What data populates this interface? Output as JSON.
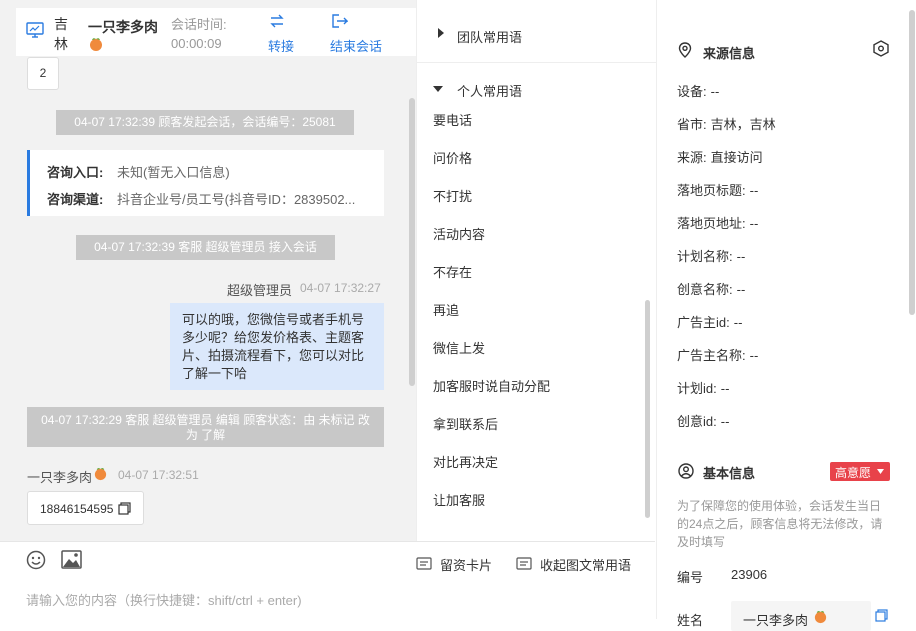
{
  "header": {
    "region": "吉林",
    "nickname": "一只李多肉",
    "session_time_label": "会话时间:",
    "session_time": "00:00:09",
    "transfer_label": "转接",
    "end_label": "结束会话"
  },
  "chat": {
    "top_count": "2",
    "sys1": "04-07 17:32:39 顾客发起会话，会话编号：25081",
    "entry_label": "咨询入口:",
    "entry_value": "未知(暂无入口信息)",
    "channel_label": "咨询渠道:",
    "channel_value": "抖音企业号/员工号(抖音号ID：2839502...",
    "sys2": "04-07 17:32:39 客服 超级管理员 接入会话",
    "agent_name": "超级管理员",
    "agent_time": "04-07 17:32:27",
    "agent_msg": "可以的哦，您微信号或者手机号多少呢？给您发价格表、主题客片、拍摄流程看下，您可以对比了解一下哈",
    "sys3": "04-07 17:32:29 客服 超级管理员 编辑 顾客状态：由 未标记 改为 了解",
    "customer_name": "一只李多肉",
    "customer_time": "04-07 17:32:51",
    "customer_msg": "18846154595"
  },
  "input": {
    "placeholder": "请输入您的内容（换行快捷键：shift/ctrl + enter)",
    "card_label": "留资卡片",
    "collapse_label": "收起图文常用语"
  },
  "phrases": {
    "team_title": "团队常用语",
    "personal_title": "个人常用语",
    "items": [
      "要电话",
      "问价格",
      "不打扰",
      "活动内容",
      "不存在",
      "再追",
      "微信上发",
      "加客服时说自动分配",
      "拿到联系后",
      "对比再决定",
      "让加客服"
    ]
  },
  "info": {
    "source_title": "来源信息",
    "rows": [
      {
        "label": "设备:",
        "value": "--"
      },
      {
        "label": "省市:",
        "value": "吉林，吉林"
      },
      {
        "label": "来源:",
        "value": "直接访问"
      },
      {
        "label": "落地页标题:",
        "value": "--"
      },
      {
        "label": "落地页地址:",
        "value": "--"
      },
      {
        "label": "计划名称:",
        "value": "--"
      },
      {
        "label": "创意名称:",
        "value": "--"
      },
      {
        "label": "广告主id:",
        "value": "--"
      },
      {
        "label": "广告主名称:",
        "value": "--"
      },
      {
        "label": "计划id:",
        "value": "--"
      },
      {
        "label": "创意id:",
        "value": "--"
      }
    ],
    "basic_title": "基本信息",
    "intent_badge": "高意愿",
    "notice": "为了保障您的使用体验，会话发生当日的24点之后，顾客信息将无法修改，请及时填写",
    "id_label": "编号",
    "id_value": "23906",
    "name_label": "姓名",
    "name_value": "一只李多肉"
  },
  "colors": {
    "accent": "#2a7be0",
    "badge": "#e8424a",
    "system_msg": "#c8c8c8",
    "bubble": "#dbe8fb"
  }
}
